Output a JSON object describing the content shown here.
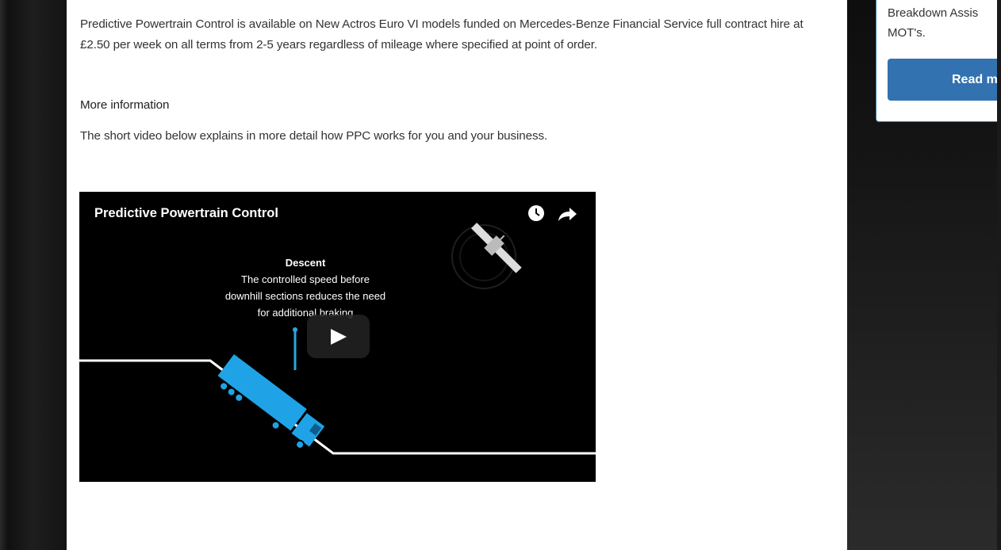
{
  "article": {
    "paragraph1": "Predictive Powertrain Control is available on New Actros Euro VI models funded on Mercedes-Benze Financial Service full contract hire at £2.50 per week on all terms from 2-5 years regardless of mileage where specified at point of order.",
    "more_heading": "More information",
    "paragraph2": "The short video below explains in more detail how PPC works for you and your business."
  },
  "video": {
    "title": "Predictive Powertrain Control",
    "caption_title": "Descent",
    "caption_line1": "The controlled speed before",
    "caption_line2": "downhill sections reduces the need",
    "caption_line3": "for additional braking",
    "watch_later_icon": "clock-icon",
    "share_icon": "share-arrow-icon",
    "play_icon": "play-icon"
  },
  "sidebar": {
    "text_line1": "Breakdown Assis",
    "text_line2": "MOT's.",
    "read_more_label": "Read m",
    "accent_color": "#3372b0"
  }
}
